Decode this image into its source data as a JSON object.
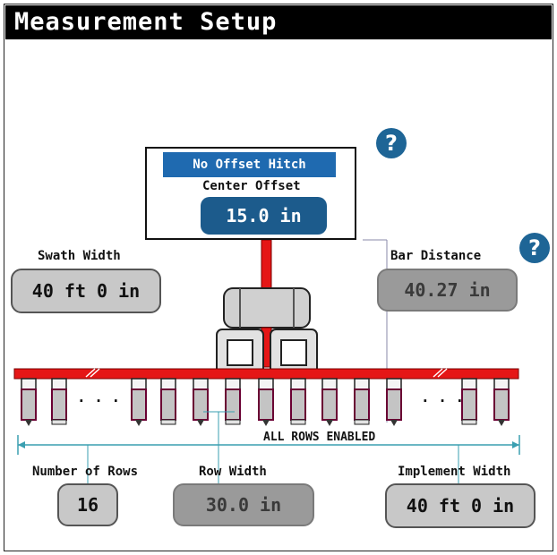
{
  "header": {
    "title": "Measurement Setup"
  },
  "hitch": {
    "mode_label": "No Offset Hitch",
    "center_offset_label": "Center Offset",
    "center_offset_value": "15.0 in"
  },
  "help": {
    "symbol": "?"
  },
  "swath": {
    "label": "Swath Width",
    "value": "40 ft 0 in"
  },
  "bar_distance": {
    "label": "Bar Distance",
    "value": "40.27 in"
  },
  "rows_status": "ALL ROWS ENABLED",
  "ellipsis": "· · ·",
  "number_of_rows": {
    "label": "Number of Rows",
    "value": "16"
  },
  "row_width": {
    "label": "Row Width",
    "value": "30.0 in"
  },
  "implement_width": {
    "label": "Implement Width",
    "value": "40 ft 0 in"
  },
  "colors": {
    "bar": "#e51616",
    "accent": "#1e6596",
    "header_bg": "#000000",
    "hitch_blue": "#1f6ab0"
  }
}
